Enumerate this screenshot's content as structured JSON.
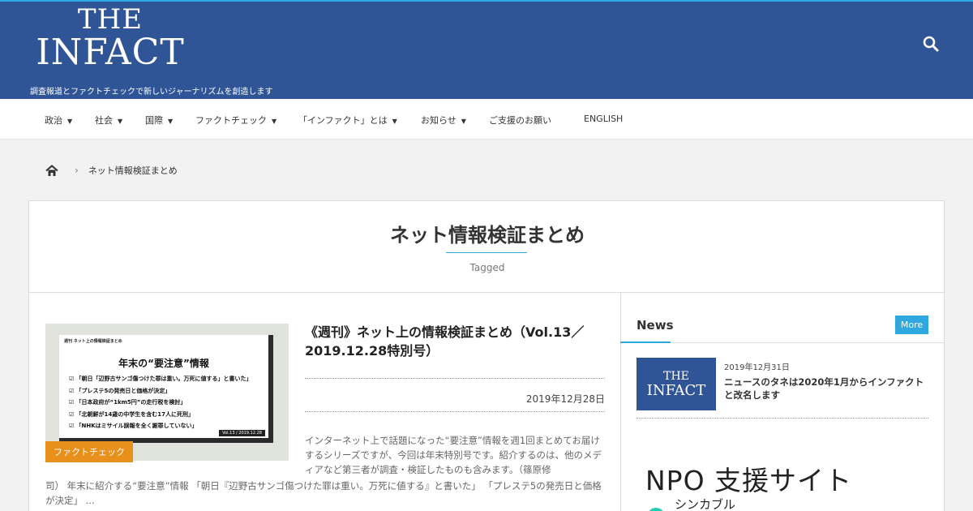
{
  "header": {
    "logo_line1": "THE",
    "logo_line2": "INFACT",
    "tagline": "調査報道とファクトチェックで新しいジャーナリズムを創造します",
    "search_icon": "search-icon",
    "colors": {
      "header_bg": "#305596",
      "accent": "#2fa8e0"
    }
  },
  "nav": {
    "items": [
      {
        "label": "政治",
        "dropdown": true
      },
      {
        "label": "社会",
        "dropdown": true
      },
      {
        "label": "国際",
        "dropdown": true
      },
      {
        "label": "ファクトチェック",
        "dropdown": true
      },
      {
        "label": "「インファクト」とは",
        "dropdown": true
      },
      {
        "label": "お知らせ",
        "dropdown": true
      },
      {
        "label": "ご支援のお願い",
        "dropdown": false
      },
      {
        "label": "ENGLISH",
        "dropdown": false
      }
    ],
    "caret": "▼"
  },
  "breadcrumb": {
    "home_icon": "home-icon",
    "separator": "›",
    "current": "ネット情報検証まとめ"
  },
  "archive": {
    "title": "ネット情報検証まとめ",
    "subtitle": "Tagged"
  },
  "post": {
    "thumbnail": {
      "kicker": "週刊 ネット上の情報検証まとめ",
      "heading": "年末の“要注意”情報",
      "lines": [
        "「朝日「辺野古サンゴ傷つけた罪は重い。万死に値する」と書いた」",
        "「プレステ5の発売日と価格が決定」",
        "「日本政府が“1km5円”の走行税を検討」",
        "「北朝鮮が14歳の中学生を含む17人に死刑」",
        "「NHKはミサイル誤報を全く謝罪していない」"
      ],
      "vol": "Vol.13 / 2019.12.28"
    },
    "category": "ファクトチェック",
    "title": "《週刊》ネット上の情報検証まとめ（Vol.13／2019.12.28特別号）",
    "date": "2019年12月28日",
    "excerpt_side": "インターネット上で話題になった“要注意”情報を週1回まとめてお届けするシリーズですが、今回は年末特別号です。紹介するのは、他のメディアなど第三者が調査・検証したものも含みます。（篠原修",
    "excerpt_full": "司） 年末に紹介する“要注意”情報 「朝日『辺野古サンゴ傷つけた罪は重い。万死に値する』と書いた」 「プレステ5の発売日と価格が決定」 ..."
  },
  "sidebar": {
    "news_title": "News",
    "more_label": "More",
    "news_item": {
      "thumb_line1": "THE",
      "thumb_line2": "INFACT",
      "date": "2019年12月31日",
      "headline": "ニュースのタネは2020年1月からインファクトと改名します"
    },
    "banner_title": "NPO 支援サイト",
    "banner_sub": "シンカブル"
  }
}
